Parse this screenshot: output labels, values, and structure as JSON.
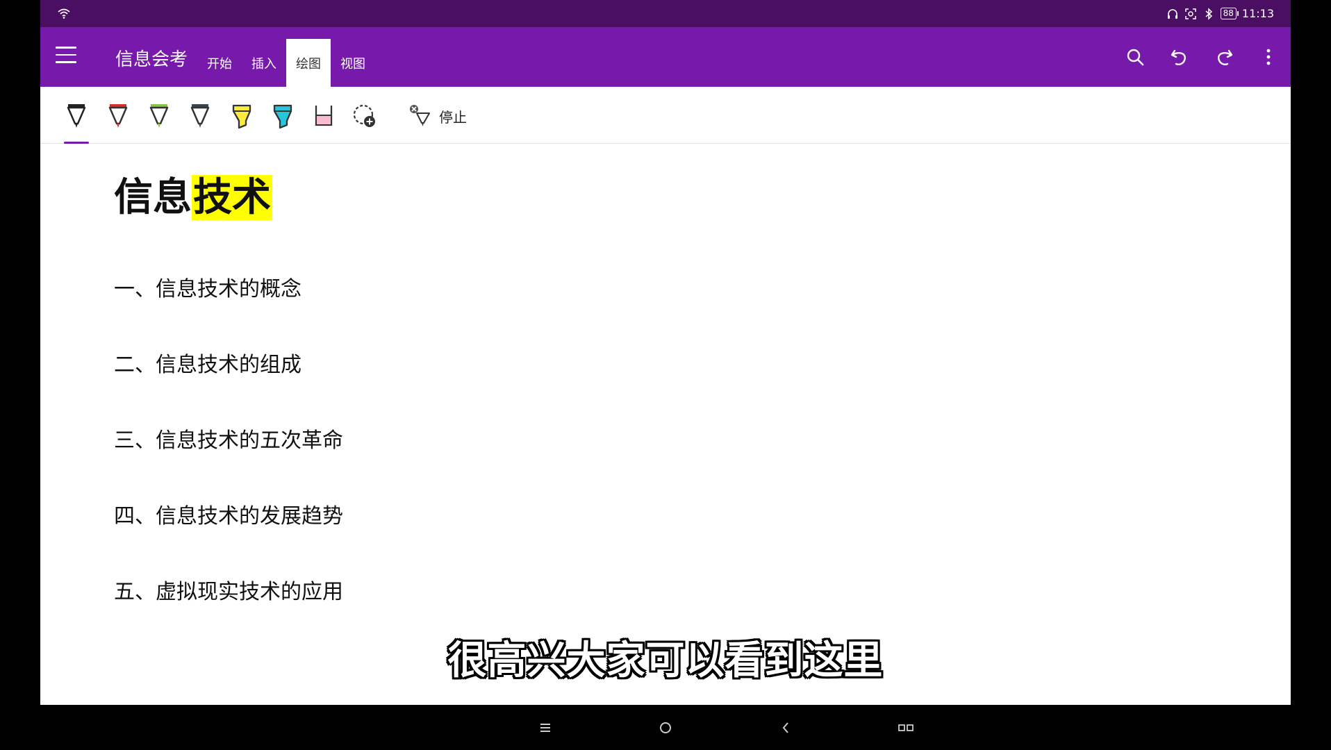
{
  "status_bar": {
    "battery": "88",
    "time": "11:13",
    "icons": [
      "wifi-icon",
      "headphones-icon",
      "screenshot-icon",
      "bluetooth-icon",
      "battery-icon"
    ]
  },
  "header": {
    "notebook_title": "信息会考",
    "tabs": [
      {
        "label": "开始",
        "active": false
      },
      {
        "label": "插入",
        "active": false
      },
      {
        "label": "绘图",
        "active": true
      },
      {
        "label": "视图",
        "active": false
      }
    ],
    "actions": [
      "search-icon",
      "undo-icon",
      "redo-icon",
      "more-icon"
    ]
  },
  "ribbon": {
    "tools": [
      {
        "name": "black-pen",
        "color": "#222222",
        "type": "pen"
      },
      {
        "name": "red-pen",
        "color": "#d32f2f",
        "type": "pen"
      },
      {
        "name": "green-pen",
        "color": "#8bc34a",
        "type": "pen"
      },
      {
        "name": "blue-pen",
        "color": "#37474f",
        "type": "pen"
      },
      {
        "name": "yellow-highlighter",
        "color": "#ffeb3b",
        "type": "highlighter"
      },
      {
        "name": "cyan-highlighter",
        "color": "#26c6da",
        "type": "highlighter"
      },
      {
        "name": "pink-highlighter",
        "color": "#f8bbd0",
        "type": "highlighter-flat"
      },
      {
        "name": "add-pen",
        "color": "#222222",
        "type": "add"
      }
    ],
    "stop_label": "停止"
  },
  "page": {
    "title_plain": "信息",
    "title_highlight": "技术",
    "highlight_color": "#ffff00",
    "items": [
      "一、信息技术的概念",
      "二、信息技术的组成",
      "三、信息技术的五次革命",
      "四、信息技术的发展趋势",
      "五、虚拟现实技术的应用"
    ]
  },
  "subtitle": "很高兴大家可以看到这里",
  "colors": {
    "status_bar": "#4a0f63",
    "app_bar": "#7719aa",
    "accent": "#7719aa"
  }
}
